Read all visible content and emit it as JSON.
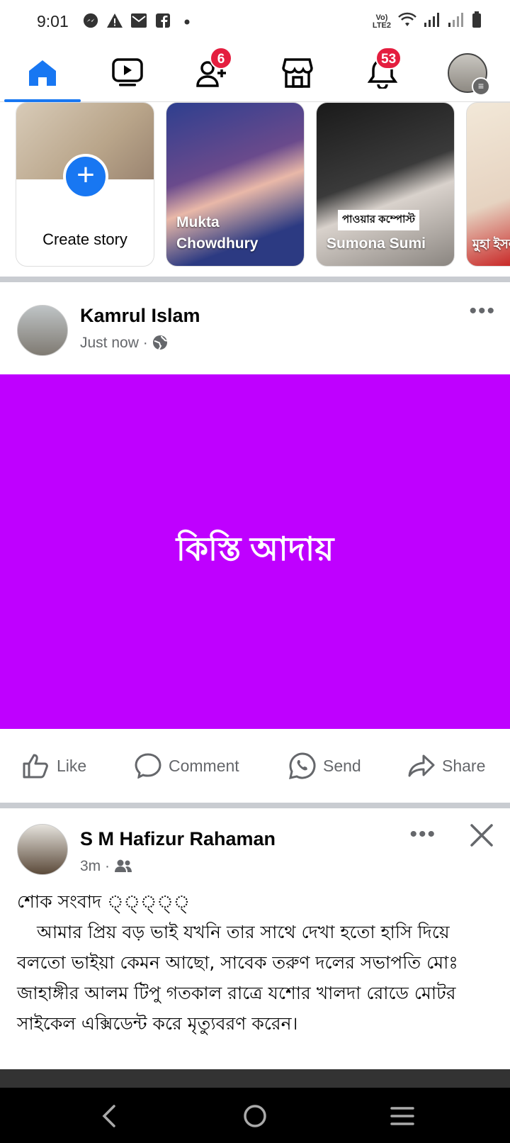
{
  "status_bar": {
    "time": "9:01",
    "left_icons": [
      "messenger-icon",
      "warning-icon",
      "mail-icon",
      "facebook-icon",
      "dot-icon"
    ],
    "right_icons": [
      "volte-icon",
      "wifi-icon",
      "signal-icon",
      "signal-icon",
      "battery-icon"
    ],
    "network_label": "VoLTE2"
  },
  "nav": {
    "tabs": [
      {
        "name": "home",
        "icon": "home-icon",
        "active": true
      },
      {
        "name": "watch",
        "icon": "video-icon",
        "active": false
      },
      {
        "name": "friends",
        "icon": "friends-icon",
        "badge": "6"
      },
      {
        "name": "marketplace",
        "icon": "marketplace-icon",
        "active": false
      },
      {
        "name": "notifications",
        "icon": "bell-icon",
        "badge": "53"
      },
      {
        "name": "menu",
        "icon": "profile-menu-icon",
        "active": false
      }
    ]
  },
  "stories": {
    "create_label": "Create story",
    "items": [
      {
        "name": "Mukta Chowdhury"
      },
      {
        "name": "Sumona Sumi",
        "tag": "পাওয়ার কম্পোস্ট"
      },
      {
        "name": "মুহা ইসলা"
      }
    ]
  },
  "post1": {
    "author": "Kamrul Islam",
    "time": "Just now",
    "privacy_icon": "globe-icon",
    "background_text": "কিস্তি আদায়",
    "background_color": "#bf00ff"
  },
  "actions": {
    "like": "Like",
    "comment": "Comment",
    "send": "Send",
    "share": "Share"
  },
  "post2": {
    "author": "S M Hafizur Rahaman",
    "time": "3m",
    "privacy_icon": "friends-icon",
    "line1": "শোক সংবাদ ◌্◌্◌্◌্◌্",
    "body": "আমার প্রিয় বড় ভাই যখনি তার সাথে দেখা হতো হাসি দিয়ে বলতো ভাইয়া কেমন আছো, সাবেক তরুণ দলের সভাপতি মোঃ জাহাঙ্গীর আলম টিপু গতকাল রাত্রে  যশোর খালদা রোডে মোটর সাইকেল  এক্সিডেন্ট করে মৃত্যুবরণ করেন।"
  },
  "colors": {
    "accent": "#1877f2",
    "badge": "#e41e3f",
    "secondary_text": "#65676b"
  }
}
